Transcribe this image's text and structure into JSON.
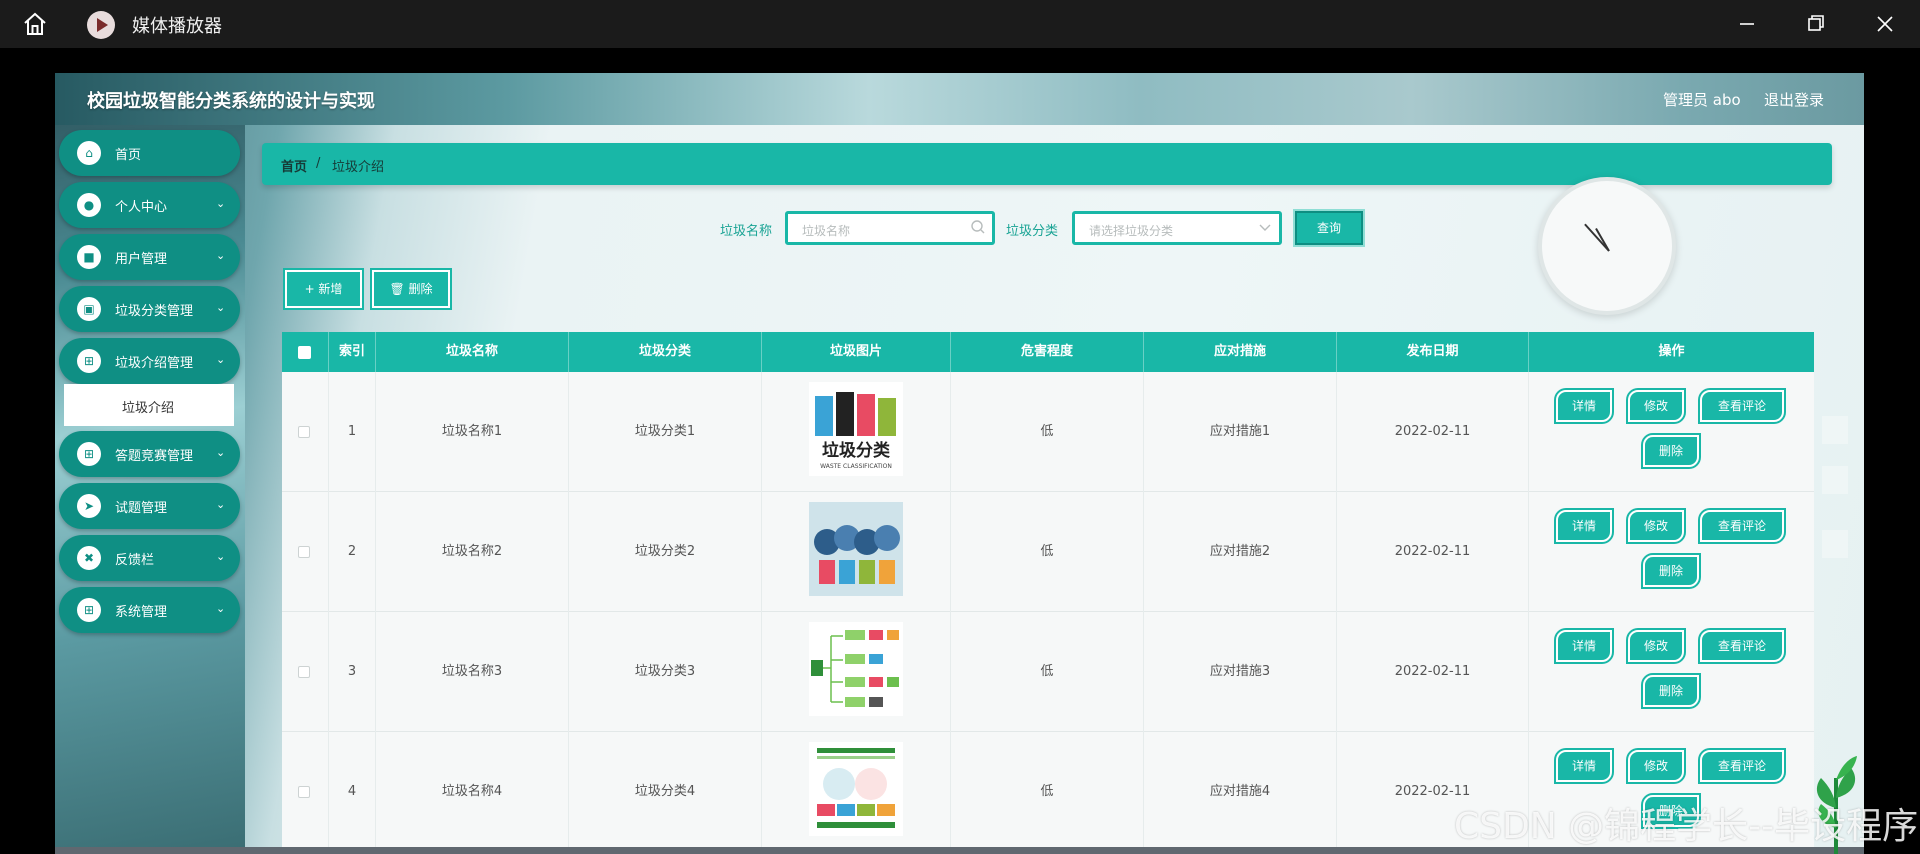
{
  "player": {
    "title": "媒体播放器",
    "icons": [
      "home-icon",
      "media-player-logo-icon",
      "minimize-icon",
      "maximize-icon",
      "close-icon"
    ]
  },
  "header": {
    "title": "校园垃圾智能分类系统的设计与实现",
    "user": "管理员 abo",
    "logout": "退出登录"
  },
  "sidebar": {
    "items": [
      {
        "label": "首页",
        "icon": "home-icon"
      },
      {
        "label": "个人中心",
        "icon": "user-icon"
      },
      {
        "label": "用户管理",
        "icon": "briefcase-icon"
      },
      {
        "label": "垃圾分类管理",
        "icon": "wallet-icon"
      },
      {
        "label": "垃圾介绍管理",
        "icon": "grid-icon"
      },
      {
        "label": "答题竞赛管理",
        "icon": "grid-icon"
      },
      {
        "label": "试题管理",
        "icon": "send-icon"
      },
      {
        "label": "反馈栏",
        "icon": "cross-icon"
      },
      {
        "label": "系统管理",
        "icon": "grid-icon"
      }
    ],
    "submenu_active": "垃圾介绍"
  },
  "breadcrumb": {
    "home": "首页",
    "separator": "/",
    "current": "垃圾介绍"
  },
  "search": {
    "name_label": "垃圾名称",
    "name_placeholder": "垃圾名称",
    "category_label": "垃圾分类",
    "category_placeholder": "请选择垃圾分类",
    "query_label": "查询"
  },
  "actions": {
    "add_label": "+ 新增",
    "delete_label": "🗑 删除"
  },
  "table": {
    "columns": [
      "索引",
      "垃圾名称",
      "垃圾分类",
      "垃圾图片",
      "危害程度",
      "应对措施",
      "发布日期",
      "操作"
    ],
    "rows": [
      {
        "index": "1",
        "name": "垃圾名称1",
        "category": "垃圾分类1",
        "image_text": "垃圾分类",
        "image_subtext": "WASTE CLASSIFICATION",
        "hazard": "低",
        "measure": "应对措施1",
        "date": "2022-02-11"
      },
      {
        "index": "2",
        "name": "垃圾名称2",
        "category": "垃圾分类2",
        "hazard": "低",
        "measure": "应对措施2",
        "date": "2022-02-11"
      },
      {
        "index": "3",
        "name": "垃圾名称3",
        "category": "垃圾分类3",
        "hazard": "低",
        "measure": "应对措施3",
        "date": "2022-02-11"
      },
      {
        "index": "4",
        "name": "垃圾名称4",
        "category": "垃圾分类4",
        "hazard": "低",
        "measure": "应对措施4",
        "date": "2022-02-11"
      }
    ],
    "row_buttons": {
      "detail": "详情",
      "edit": "修改",
      "comments": "查看评论",
      "delete": "删除"
    }
  },
  "watermark": "CSDN @锦程学长--毕设程序",
  "colors": {
    "accent": "#19b7a7",
    "sidebar": "#0f8f84",
    "titlebar": "#1b1b1b"
  }
}
